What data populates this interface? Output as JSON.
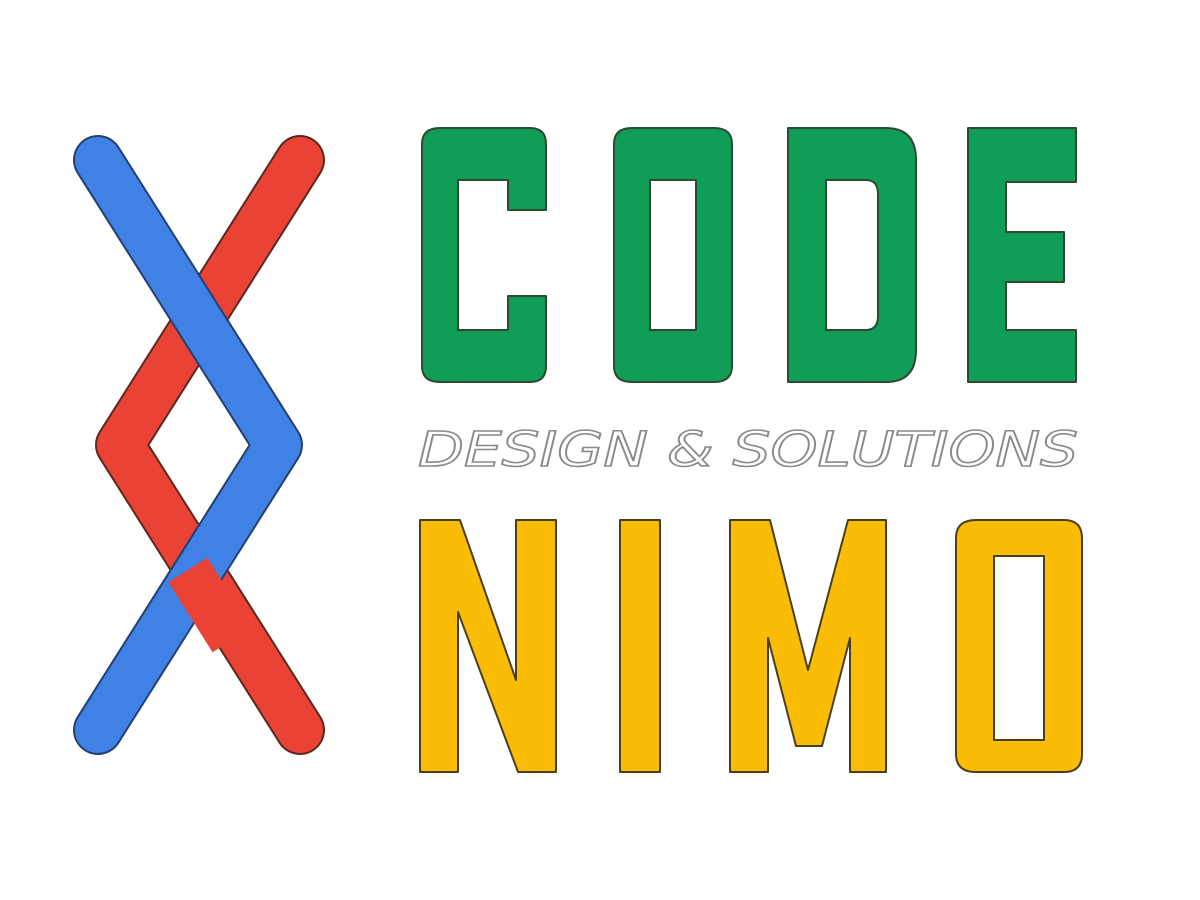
{
  "logo": {
    "word_top": "CODE",
    "tagline": "DESIGN & SOLUTIONS",
    "word_bottom": "NIMO"
  },
  "colors": {
    "background": "#ffffff",
    "mark_red": "#ea4335",
    "mark_blue": "#4081e6",
    "code_green": "#0f9d58",
    "nimo_yellow": "#fbbc05",
    "tagline_outline": "#8a8a8a",
    "letter_edge": "#3d3d2e"
  },
  "icons": {
    "mark": "crossed-chevron-mark-icon"
  }
}
